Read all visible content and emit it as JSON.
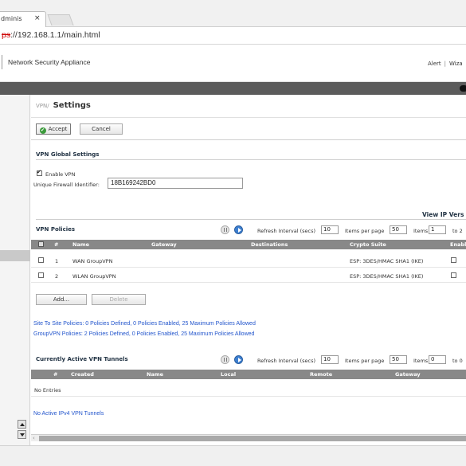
{
  "browser": {
    "tab_title": "dminis",
    "tab_close": "×",
    "url_protocol": "ps",
    "url_rest": "://192.168.1.1/main.html"
  },
  "header": {
    "brand": "Network Security Appliance",
    "alert": "Alert",
    "separator": "|",
    "wizard": "Wiza"
  },
  "page": {
    "breadcrumb_section": "VPN/",
    "title": "Settings",
    "accept_label": "Accept",
    "cancel_label": "Cancel"
  },
  "global_settings": {
    "title": "VPN Global Settings",
    "enable_vpn_label": "Enable VPN",
    "enable_vpn_checked": true,
    "firewall_id_label": "Unique Firewall Identifier:",
    "firewall_id_value": "18B169242BD0"
  },
  "view_ip_version": "View IP Vers",
  "policies": {
    "title": "VPN Policies",
    "refresh_label": "Refresh Interval (secs)",
    "refresh_value": "10",
    "items_per_page_label": "Items per page",
    "items_per_page_value": "50",
    "items_label": "Items",
    "items_value": "1",
    "to_label": "to 2",
    "columns": [
      "#",
      "Name",
      "Gateway",
      "Destinations",
      "Crypto Suite",
      "Enable"
    ],
    "rows": [
      {
        "num": "1",
        "name": "WAN GroupVPN",
        "gateway": "",
        "destinations": "",
        "crypto": "ESP: 3DES/HMAC SHA1 (IKE)"
      },
      {
        "num": "2",
        "name": "WLAN GroupVPN",
        "gateway": "",
        "destinations": "",
        "crypto": "ESP: 3DES/HMAC SHA1 (IKE)"
      }
    ],
    "add_label": "Add...",
    "delete_label": "Delete",
    "site_to_site_summary": "Site To Site Policies: 0 Policies Defined, 0 Policies Enabled, 25 Maximum Policies Allowed",
    "group_vpn_summary": "GroupVPN Policies: 2 Policies Defined, 0 Policies Enabled, 25 Maximum Policies Allowed"
  },
  "tunnels": {
    "title": "Currently Active VPN Tunnels",
    "refresh_label": "Refresh Interval (secs)",
    "refresh_value": "10",
    "items_per_page_label": "Items per page",
    "items_per_page_value": "50",
    "items_label": "Items",
    "items_value": "0",
    "to_label": "to 0",
    "columns": [
      "#",
      "Created",
      "Name",
      "Local",
      "Remote",
      "Gateway"
    ],
    "empty_text": "No Entries",
    "ipv4_summary": "No Active IPv4 VPN Tunnels"
  },
  "colors": {
    "link": "#2255cc",
    "table_header": "#888888",
    "accept_icon": "#3b9a3b",
    "play_button": "#3d7fd0"
  }
}
